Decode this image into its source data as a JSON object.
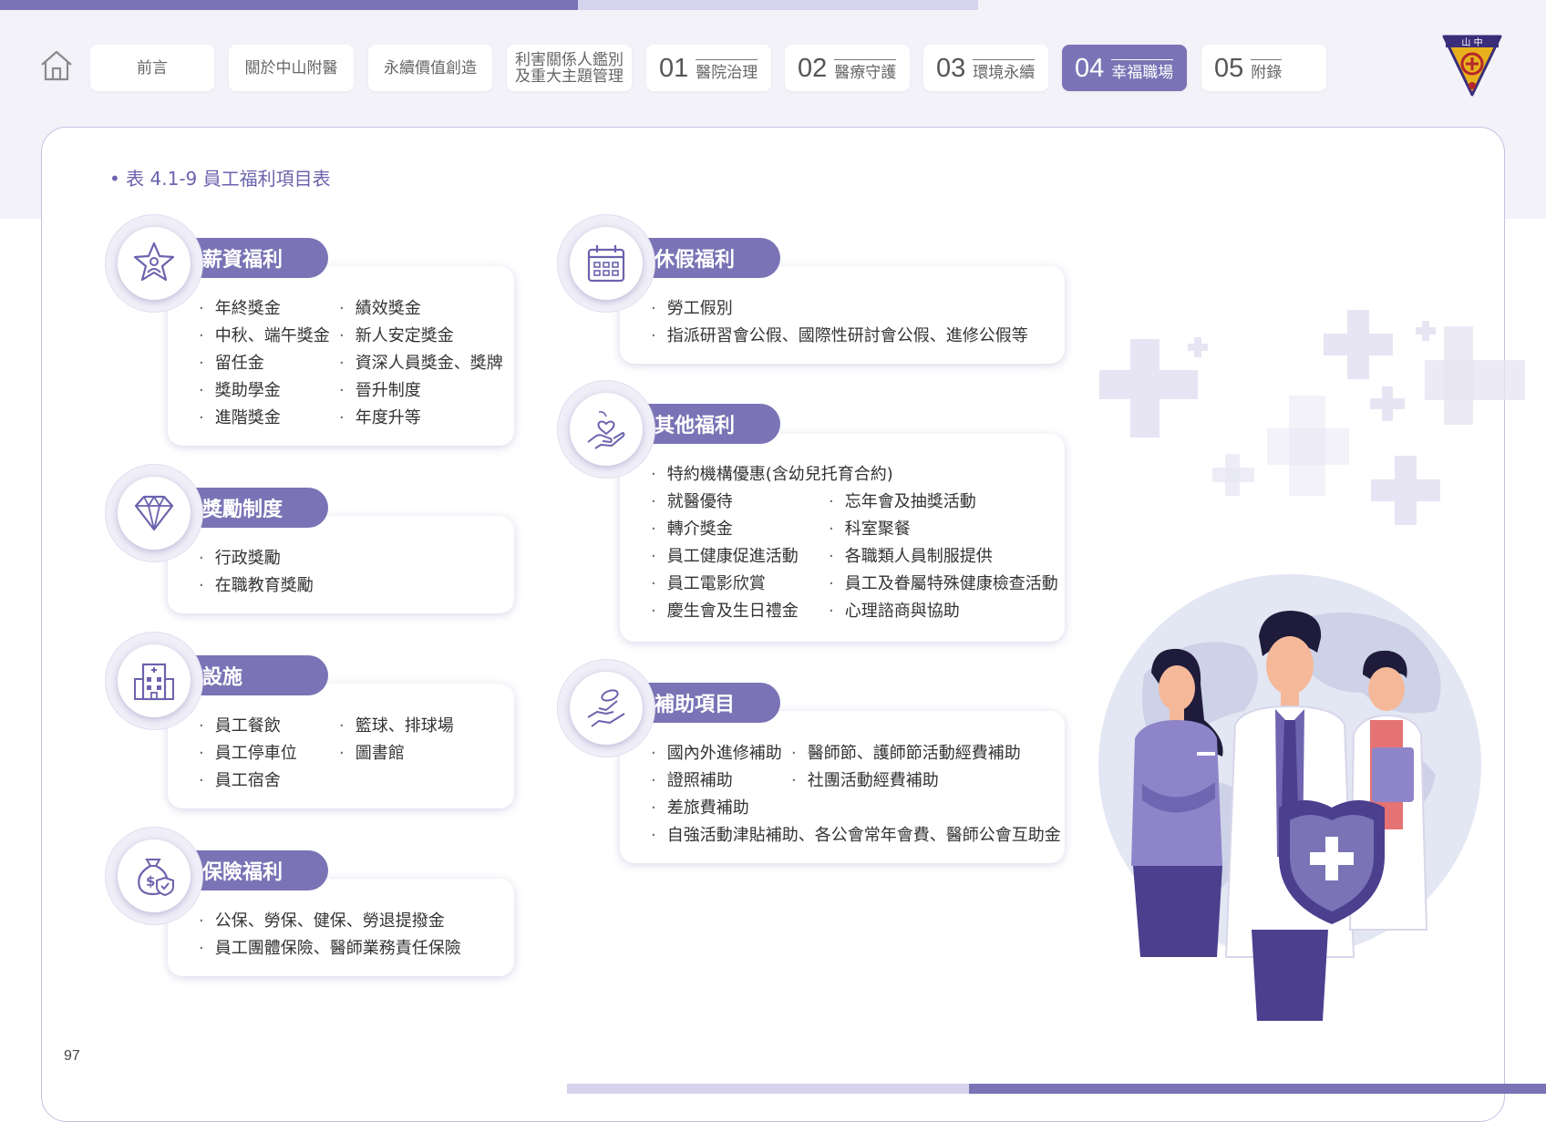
{
  "nav": {
    "tabs": [
      {
        "label": "前言"
      },
      {
        "label": "關於中山附醫"
      },
      {
        "label": "永續價值創造"
      },
      {
        "label": "利害關係人鑑別\n及重大主題管理"
      },
      {
        "num": "01",
        "label": "醫院治理"
      },
      {
        "num": "02",
        "label": "醫療守護"
      },
      {
        "num": "03",
        "label": "環境永續"
      },
      {
        "num": "04",
        "label": "幸福職場",
        "active": true
      },
      {
        "num": "05",
        "label": "附錄"
      }
    ],
    "logo_text": "中山"
  },
  "table_title": "表 4.1-9 員工福利項目表",
  "sections": {
    "salary": {
      "title": "薪資福利",
      "icon": "star-person-icon",
      "col1": [
        "年終獎金",
        "中秋、端午獎金",
        "留任金",
        "獎助學金",
        "進階獎金"
      ],
      "col2": [
        "績效獎金",
        "新人安定獎金",
        "資深人員獎金、獎牌",
        "晉升制度",
        "年度升等"
      ]
    },
    "reward": {
      "title": "獎勵制度",
      "icon": "diamond-icon",
      "col1": [
        "行政獎勵",
        "在職教育獎勵"
      ]
    },
    "facility": {
      "title": "設施",
      "icon": "building-icon",
      "col1": [
        "員工餐飲",
        "員工停車位",
        "員工宿舍"
      ],
      "col2": [
        "籃球、排球場",
        "圖書館"
      ]
    },
    "insurance": {
      "title": "保險福利",
      "icon": "money-bag-shield-icon",
      "col1": [
        "公保、勞保、健保、勞退提撥金",
        "員工團體保險、醫師業務責任保險"
      ]
    },
    "leave": {
      "title": "休假福利",
      "icon": "calendar-icon",
      "col1": [
        "勞工假別",
        "指派研習會公假、國際性研討會公假、進修公假等"
      ]
    },
    "other": {
      "title": "其他福利",
      "icon": "heart-hand-icon",
      "top": "特約機構優惠(含幼兒托育合約)",
      "col1": [
        "就醫優待",
        "轉介獎金",
        "員工健康促進活動",
        "員工電影欣賞",
        "慶生會及生日禮金"
      ],
      "col2": [
        "忘年會及抽獎活動",
        "科室聚餐",
        "各職類人員制服提供",
        "員工及眷屬特殊健康檢查活動",
        "心理諮商與協助"
      ]
    },
    "subsidy": {
      "title": "補助項目",
      "icon": "hand-coin-icon",
      "col1": [
        "國內外進修補助",
        "證照補助",
        "差旅費補助"
      ],
      "col2": [
        "醫師節、護師節活動經費補助",
        "社團活動經費補助"
      ],
      "bottom": "自強活動津貼補助、各公會常年會費、醫師公會互助金"
    }
  },
  "page_number": "97",
  "colors": {
    "accent": "#7a73b5",
    "accent_light": "#d6d3ec",
    "title": "#6b63ad"
  }
}
